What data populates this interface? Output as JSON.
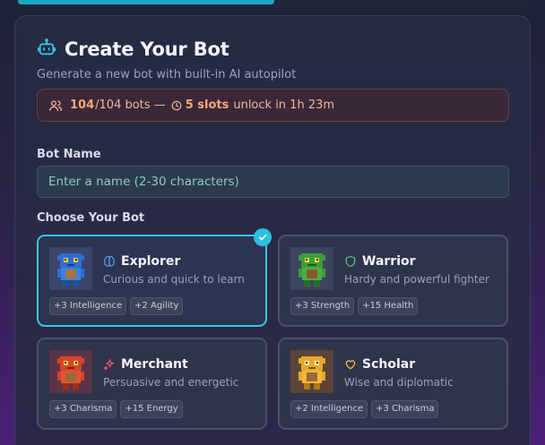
{
  "header": {
    "title": "Create Your Bot",
    "subtitle": "Generate a new bot with built-in AI autopilot"
  },
  "limit_banner": {
    "count": "104",
    "total_suffix": "/104 bots —",
    "slots": "5 slots",
    "unlock_text": "unlock in 1h 23m",
    "color": "#f6a977"
  },
  "form": {
    "name_label": "Bot Name",
    "name_placeholder": "Enter a name (2-30 characters)",
    "choose_label": "Choose Your Bot"
  },
  "bots": [
    {
      "name": "Explorer",
      "description": "Curious and quick to learn",
      "icon": "brain-icon",
      "color": "#3a78d8",
      "tags": [
        "+3 Intelligence",
        "+2 Agility"
      ],
      "selected": true
    },
    {
      "name": "Warrior",
      "description": "Hardy and powerful fighter",
      "icon": "shield-icon",
      "color": "#3fa045",
      "tags": [
        "+3 Strength",
        "+15 Health"
      ],
      "selected": false
    },
    {
      "name": "Merchant",
      "description": "Persuasive and energetic",
      "icon": "sparkle-icon",
      "color": "#d8442a",
      "tags": [
        "+3 Charisma",
        "+15 Energy"
      ],
      "selected": false
    },
    {
      "name": "Scholar",
      "description": "Wise and diplomatic",
      "icon": "heart-icon",
      "color": "#e8a82a",
      "tags": [
        "+2 Intelligence",
        "+3 Charisma"
      ],
      "selected": false
    }
  ],
  "accent_color": "#36c6e0"
}
